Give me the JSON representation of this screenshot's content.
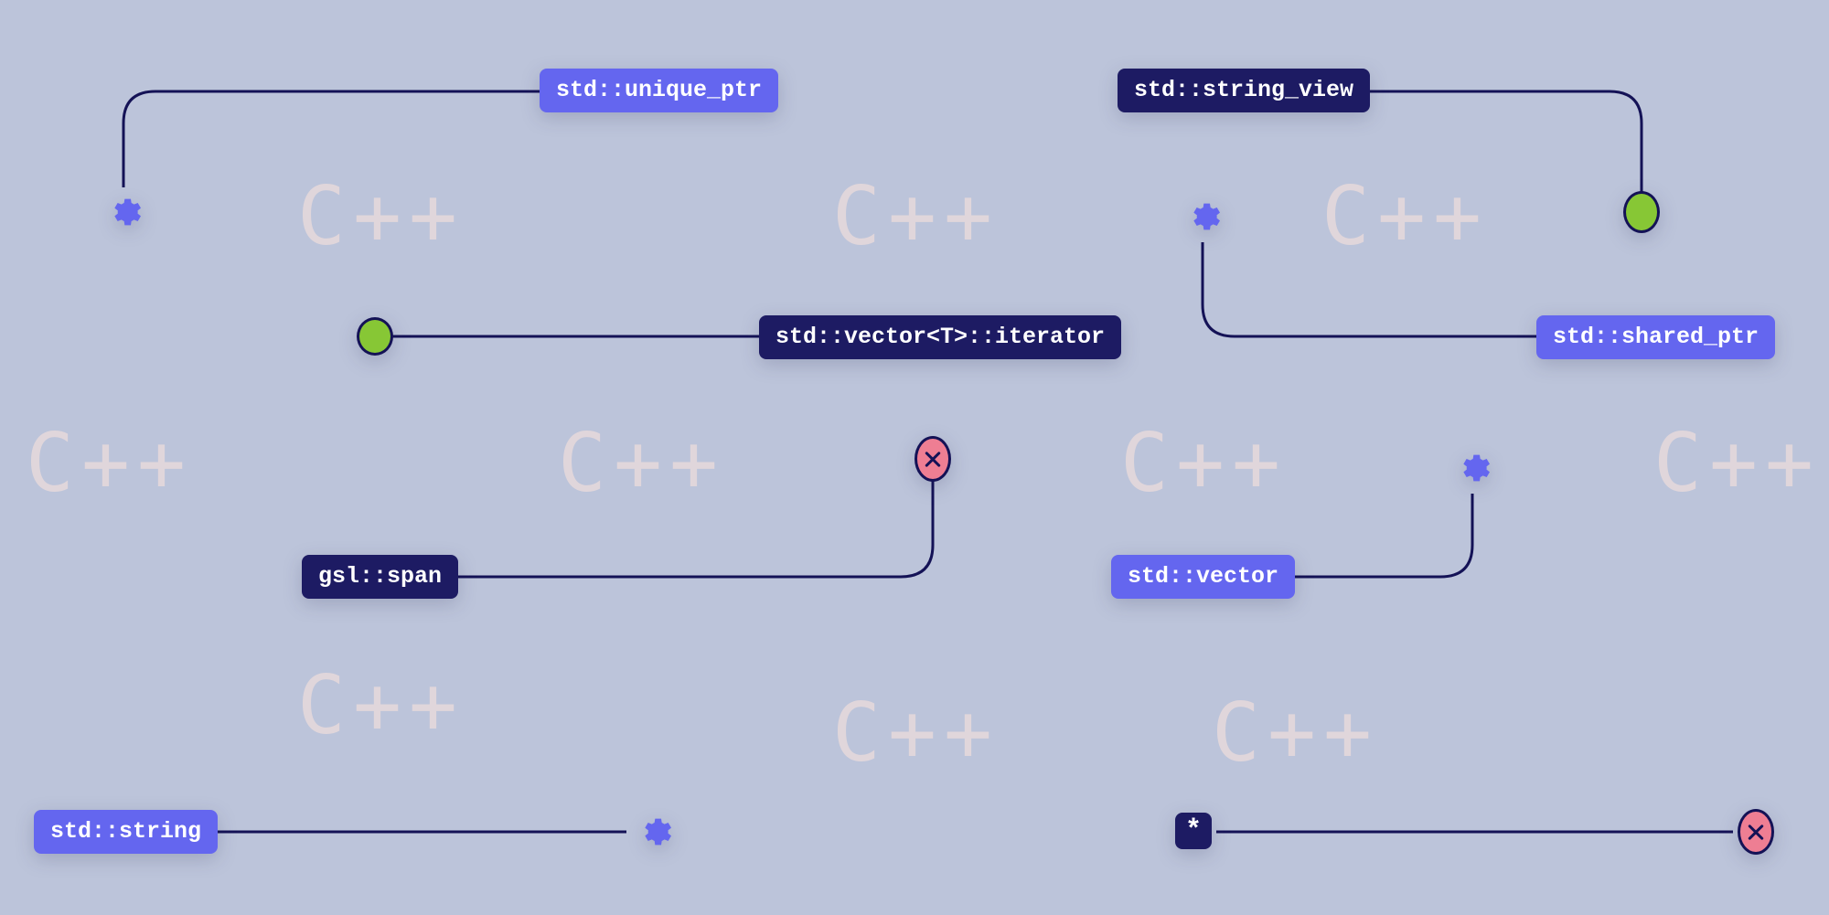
{
  "background_text": "C++",
  "colors": {
    "bg": "#bcc4da",
    "indigo": "#1d1b63",
    "violet": "#6466ef",
    "green": "#87c735",
    "pink": "#ee7e93",
    "wire": "#141256"
  },
  "tags": {
    "unique_ptr": "std::unique_ptr",
    "string_view": "std::string_view",
    "vector_iterator": "std::vector<T>::iterator",
    "shared_ptr": "std::shared_ptr",
    "gsl_span": "gsl::span",
    "std_vector": "std::vector",
    "std_string": "std::string",
    "raw_ptr": "*"
  }
}
